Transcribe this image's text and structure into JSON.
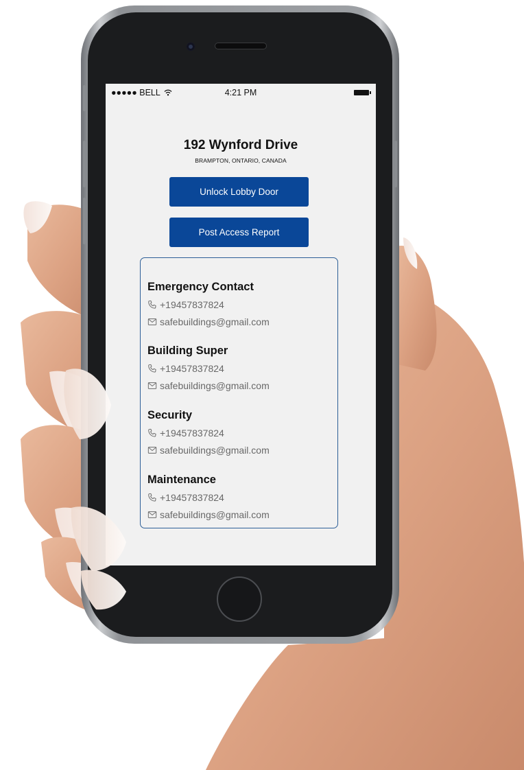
{
  "status_bar": {
    "carrier": "BELL",
    "time": "4:21 PM"
  },
  "building": {
    "name": "192 Wynford Drive",
    "location": "BRAMPTON, ONTARIO, CANADA"
  },
  "actions": {
    "unlock_label": "Unlock Lobby Door",
    "report_label": "Post Access Report"
  },
  "contacts": [
    {
      "title": "Emergency Contact",
      "phone": "+19457837824",
      "email": "safebuildings@gmail.com"
    },
    {
      "title": "Building Super",
      "phone": "+19457837824",
      "email": "safebuildings@gmail.com"
    },
    {
      "title": "Security",
      "phone": "+19457837824",
      "email": "safebuildings@gmail.com"
    },
    {
      "title": "Maintenance",
      "phone": "+19457837824",
      "email": "safebuildings@gmail.com"
    }
  ],
  "colors": {
    "primary_button": "#0a4798",
    "card_border": "#2c5e97",
    "screen_background": "#f1f1f1"
  },
  "icons": {
    "phone": "phone-icon",
    "email": "mail-icon"
  }
}
